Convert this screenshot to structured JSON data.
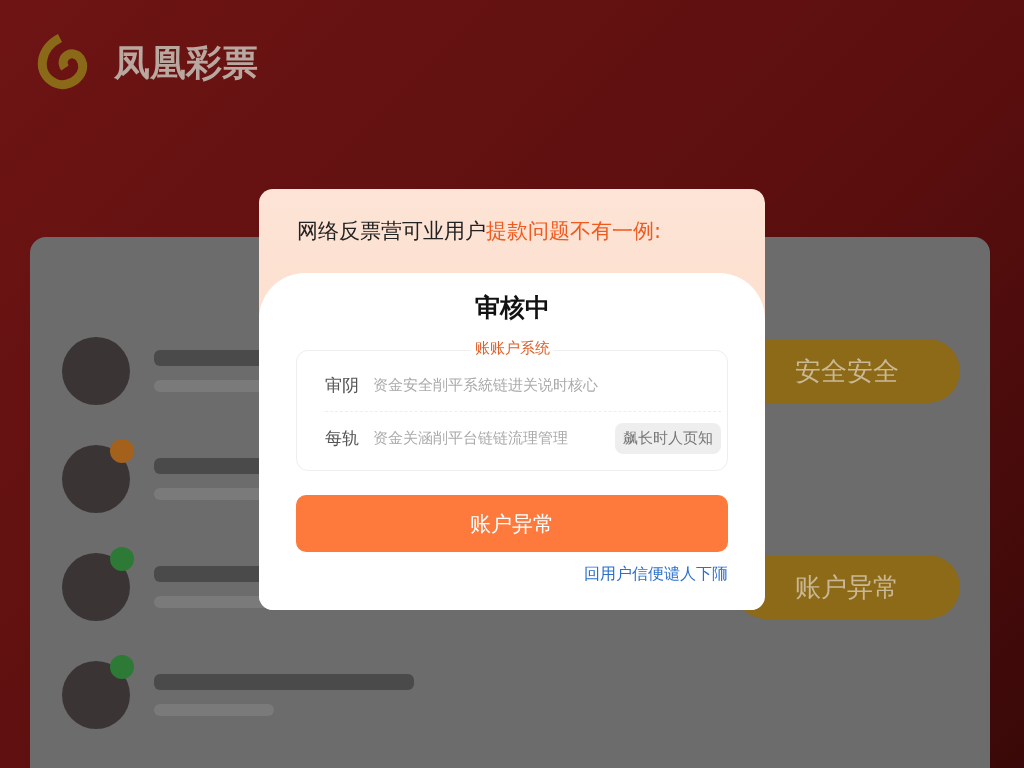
{
  "background": {
    "logo": {
      "name": "凤凰彩票"
    },
    "list_rows": [
      {
        "action": "安全安全"
      },
      {
        "color": "#a4611c"
      },
      {
        "color": "#2c7a36",
        "action": "账户异常"
      },
      {
        "color": "#2c7a36"
      }
    ]
  },
  "dialog": {
    "header_lead": "网络反票营可业用户",
    "header_highlight": "提款问题不有一例:",
    "title": "审核中",
    "section_label": "账账户系统",
    "rows": [
      {
        "label": "审阴",
        "value": "资金安全削平系統链进关说时核心"
      },
      {
        "label": "每轨",
        "value": "资金关涵削平台链链流理管理",
        "action": "飙长时人页知"
      }
    ],
    "primary_button": "账户异常",
    "link": "回用户信便谴人下陑"
  }
}
